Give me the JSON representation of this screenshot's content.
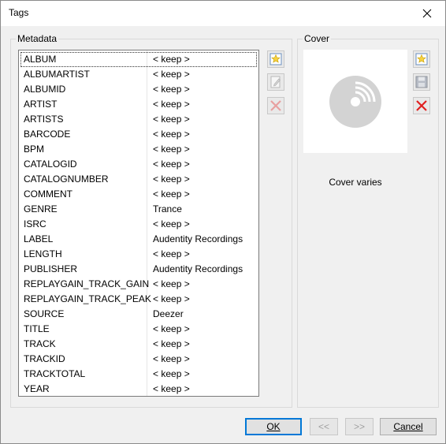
{
  "window": {
    "title": "Tags"
  },
  "metadata": {
    "group_label": "Metadata",
    "rows": [
      {
        "key": "ALBUM",
        "value": "< keep >"
      },
      {
        "key": "ALBUMARTIST",
        "value": "< keep >"
      },
      {
        "key": "ALBUMID",
        "value": "< keep >"
      },
      {
        "key": "ARTIST",
        "value": "< keep >"
      },
      {
        "key": "ARTISTS",
        "value": "< keep >"
      },
      {
        "key": "BARCODE",
        "value": "< keep >"
      },
      {
        "key": "BPM",
        "value": "< keep >"
      },
      {
        "key": "CATALOGID",
        "value": "< keep >"
      },
      {
        "key": "CATALOGNUMBER",
        "value": "< keep >"
      },
      {
        "key": "COMMENT",
        "value": "< keep >"
      },
      {
        "key": "GENRE",
        "value": "Trance"
      },
      {
        "key": "ISRC",
        "value": "< keep >"
      },
      {
        "key": "LABEL",
        "value": "Audentity Recordings"
      },
      {
        "key": "LENGTH",
        "value": "< keep >"
      },
      {
        "key": "PUBLISHER",
        "value": "Audentity Recordings"
      },
      {
        "key": "REPLAYGAIN_TRACK_GAIN",
        "value": "< keep >"
      },
      {
        "key": "REPLAYGAIN_TRACK_PEAK",
        "value": "< keep >"
      },
      {
        "key": "SOURCE",
        "value": "Deezer"
      },
      {
        "key": "TITLE",
        "value": "< keep >"
      },
      {
        "key": "TRACK",
        "value": "< keep >"
      },
      {
        "key": "TRACKID",
        "value": "< keep >"
      },
      {
        "key": "TRACKTOTAL",
        "value": "< keep >"
      },
      {
        "key": "YEAR",
        "value": "< keep >"
      }
    ],
    "buttons": [
      {
        "name": "add-tag-button",
        "icon": "star-new-icon"
      },
      {
        "name": "edit-tag-button",
        "icon": "edit-icon"
      },
      {
        "name": "remove-tag-button",
        "icon": "delete-x-icon"
      }
    ]
  },
  "cover": {
    "group_label": "Cover",
    "status_text": "Cover varies",
    "placeholder_icon": "disc-icon",
    "buttons": [
      {
        "name": "add-cover-button",
        "icon": "star-new-icon"
      },
      {
        "name": "save-cover-button",
        "icon": "floppy-disk-icon"
      },
      {
        "name": "remove-cover-button",
        "icon": "delete-x-icon"
      }
    ]
  },
  "footer": {
    "ok_label": "OK",
    "prev_label": "<<",
    "next_label": ">>",
    "cancel_label": "Cancel"
  },
  "colors": {
    "accent": "#0078d7",
    "delete": "#e02020",
    "disabled": "#a0a0a0"
  }
}
